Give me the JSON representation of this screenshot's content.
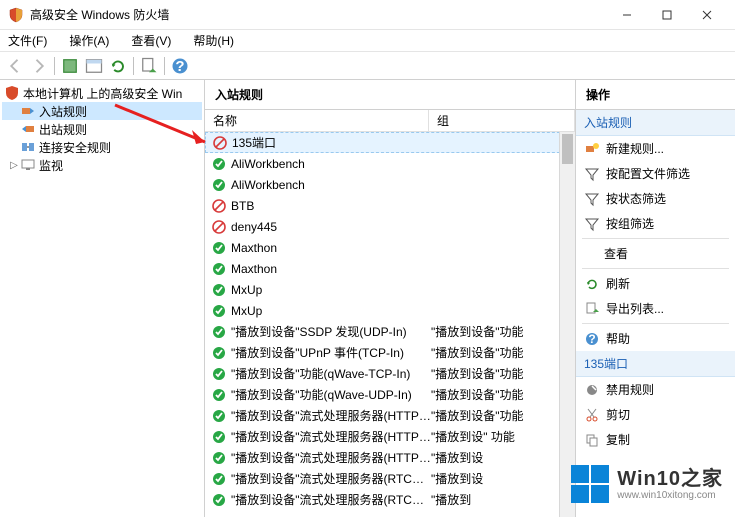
{
  "window": {
    "title": "高级安全 Windows 防火墙"
  },
  "menu": {
    "file": "文件(F)",
    "action": "操作(A)",
    "view": "查看(V)",
    "help": "帮助(H)"
  },
  "tree": {
    "root": "本地计算机 上的高级安全 Win",
    "inbound": "入站规则",
    "outbound": "出站规则",
    "conn": "连接安全规则",
    "monitor": "监视"
  },
  "list": {
    "title": "入站规则",
    "col_name": "名称",
    "col_group": "组",
    "rows": [
      {
        "status": "block",
        "name": "135端口",
        "group": "",
        "selected": true
      },
      {
        "status": "allow",
        "name": "AliWorkbench",
        "group": ""
      },
      {
        "status": "allow",
        "name": "AliWorkbench",
        "group": ""
      },
      {
        "status": "block",
        "name": "BTB",
        "group": ""
      },
      {
        "status": "block",
        "name": "deny445",
        "group": ""
      },
      {
        "status": "allow",
        "name": "Maxthon",
        "group": ""
      },
      {
        "status": "allow",
        "name": "Maxthon",
        "group": ""
      },
      {
        "status": "allow",
        "name": "MxUp",
        "group": ""
      },
      {
        "status": "allow",
        "name": "MxUp",
        "group": ""
      },
      {
        "status": "allow",
        "name": "\"播放到设备\"SSDP 发现(UDP-In)",
        "group": "\"播放到设备\"功能"
      },
      {
        "status": "allow",
        "name": "\"播放到设备\"UPnP 事件(TCP-In)",
        "group": "\"播放到设备\"功能"
      },
      {
        "status": "allow",
        "name": "\"播放到设备\"功能(qWave-TCP-In)",
        "group": "\"播放到设备\"功能"
      },
      {
        "status": "allow",
        "name": "\"播放到设备\"功能(qWave-UDP-In)",
        "group": "\"播放到设备\"功能"
      },
      {
        "status": "allow",
        "name": "\"播放到设备\"流式处理服务器(HTTP-Stre...",
        "group": "\"播放到设备\"功能"
      },
      {
        "status": "allow",
        "name": "\"播放到设备\"流式处理服务器(HTTP-Stre...",
        "group": "\"播放到设\" 功能"
      },
      {
        "status": "allow",
        "name": "\"播放到设备\"流式处理服务器(HTTP-Stre...",
        "group": "\"播放到设"
      },
      {
        "status": "allow",
        "name": "\"播放到设备\"流式处理服务器(RTCP-Stre...",
        "group": "\"播放到设"
      },
      {
        "status": "allow",
        "name": "\"播放到设备\"流式处理服务器(RTCP-Stre...",
        "group": "\"播放到"
      }
    ]
  },
  "actions": {
    "header": "操作",
    "group1": "入站规则",
    "new_rule": "新建规则...",
    "filter_profile": "按配置文件筛选",
    "filter_state": "按状态筛选",
    "filter_group": "按组筛选",
    "view": "查看",
    "refresh": "刷新",
    "export": "导出列表...",
    "help": "帮助",
    "group2": "135端口",
    "disable": "禁用规则",
    "cut": "剪切",
    "copy": "复制"
  },
  "watermark": {
    "main": "Win10之家",
    "sub": "www.win10xitong.com"
  },
  "colors": {
    "allow": "#28a745",
    "block": "#d83b3b",
    "accent": "#0a84d8"
  }
}
